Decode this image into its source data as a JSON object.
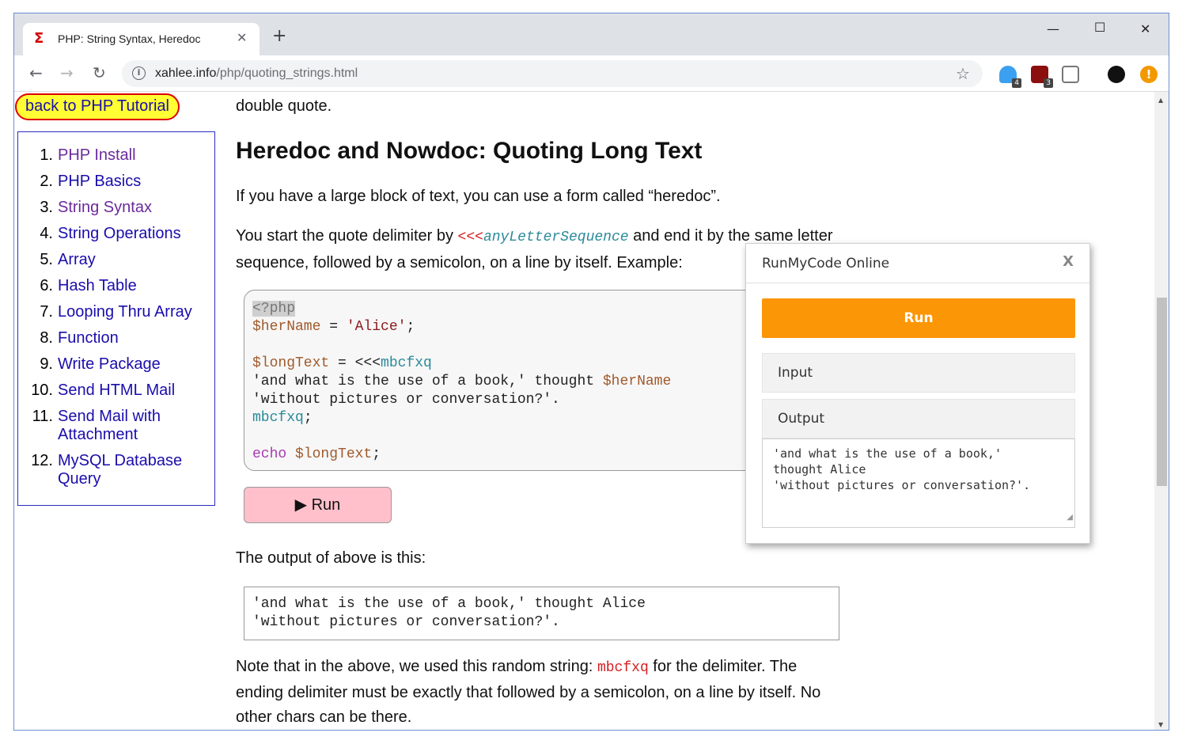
{
  "browser": {
    "tab_title": "PHP: String Syntax, Heredoc",
    "tab_favicon": "Σ",
    "url_host": "xahlee.info",
    "url_path": "/php/quoting_strings.html",
    "ext_badge_1": "4",
    "ext_badge_2": "3"
  },
  "sidebar": {
    "back_label": "back to PHP Tutorial",
    "items": [
      {
        "num": "1.",
        "label": "PHP Install"
      },
      {
        "num": "2.",
        "label": "PHP Basics"
      },
      {
        "num": "3.",
        "label": "String Syntax"
      },
      {
        "num": "4.",
        "label": "String Operations"
      },
      {
        "num": "5.",
        "label": "Array"
      },
      {
        "num": "6.",
        "label": "Hash Table"
      },
      {
        "num": "7.",
        "label": "Looping Thru Array"
      },
      {
        "num": "8.",
        "label": "Function"
      },
      {
        "num": "9.",
        "label": "Write Package"
      },
      {
        "num": "10.",
        "label": "Send HTML Mail"
      },
      {
        "num": "11.",
        "label": "Send Mail with Attachment"
      },
      {
        "num": "12.",
        "label": "MySQL Database Query"
      }
    ]
  },
  "article": {
    "p_top": "double quote.",
    "heading": "Heredoc and Nowdoc: Quoting Long Text",
    "p1": "If you have a large block of text, you can use a form called “heredoc”.",
    "p2_a": "You start the quote delimiter by ",
    "p2_code_a": "<<<",
    "p2_code_b": "anyLetterSequence",
    "p2_b": " and end it by the same letter sequence, followed by a semicolon, on a line by itself. Example:",
    "code": {
      "l1": "<?php",
      "l2_var": "$herName",
      "l2_op": " = ",
      "l2_str": "'Alice'",
      "l2_end": ";",
      "l4_var": "$longText",
      "l4_op": " = <<<",
      "l4_delim": "mbcfxq",
      "l5_a": "'and what is the use of a book,' thought ",
      "l5_var": "$herName",
      "l6": "'without pictures or conversation?'.",
      "l7_delim": "mbcfxq",
      "l7_end": ";",
      "l9_kw": "echo",
      "l9_var": " $longText",
      "l9_end": ";"
    },
    "run_label": "▶ Run",
    "p3": "The output of above is this:",
    "output": "'and what is the use of a book,' thought Alice\n'without pictures or conversation?'.",
    "p4_a": "Note that in the above, we used this random string: ",
    "p4_code": "mbcfxq",
    "p4_b": " for the delimiter. The ending delimiter must be exactly that followed by a semicolon, on a line by itself. No other chars can be there."
  },
  "popup": {
    "title": "RunMyCode Online",
    "close": "X",
    "run": "Run",
    "input": "Input",
    "output_label": "Output",
    "output_text": "'and what is the use of a book,'\nthought Alice\n'without pictures or conversation?'."
  }
}
